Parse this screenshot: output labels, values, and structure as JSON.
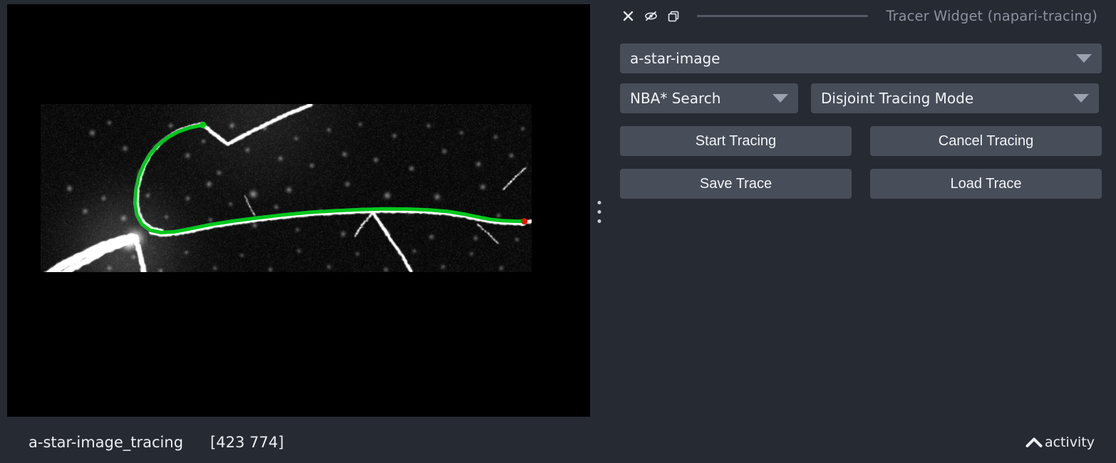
{
  "window": {
    "background_color": "#262a33",
    "panel_color": "#262a33",
    "control_color": "#474d59"
  },
  "dock": {
    "title": "Tracer Widget (napari-tracing)",
    "header_icons": [
      {
        "name": "close-icon",
        "glyph": "x"
      },
      {
        "name": "hide-icon",
        "glyph": "eye-slash"
      },
      {
        "name": "float-icon",
        "glyph": "duplicate-windows"
      }
    ],
    "layer_select": {
      "value": "a-star-image",
      "arrow": "chevron-down-icon"
    },
    "search_select": {
      "value": "NBA* Search",
      "arrow": "chevron-down-icon"
    },
    "mode_select": {
      "value": "Disjoint Tracing Mode",
      "arrow": "chevron-down-icon"
    },
    "buttons": {
      "start_tracing": "Start Tracing",
      "cancel_tracing": "Cancel Tracing",
      "save_trace": "Save Trace",
      "load_trace": "Load Trace"
    }
  },
  "viewer": {
    "image_name": "a-star-image",
    "overlay": {
      "trace_color": "#00c81e",
      "endpoint_color": "#e01b00",
      "start_point_color": "#00c81e"
    }
  },
  "statusbar": {
    "layer_label": "a-star-image_tracing",
    "coordinates": "[423 774]",
    "activity_label": "activity",
    "activity_icon": "chevron-up-icon"
  },
  "chart_data": {
    "type": "scatter",
    "title": "traced neurite path overlay",
    "trace_points_normalized": [
      [
        0.33,
        0.125
      ],
      [
        0.305,
        0.14
      ],
      [
        0.28,
        0.165
      ],
      [
        0.258,
        0.2
      ],
      [
        0.238,
        0.245
      ],
      [
        0.222,
        0.3
      ],
      [
        0.21,
        0.36
      ],
      [
        0.2,
        0.43
      ],
      [
        0.194,
        0.51
      ],
      [
        0.192,
        0.59
      ],
      [
        0.196,
        0.66
      ],
      [
        0.206,
        0.715
      ],
      [
        0.222,
        0.75
      ],
      [
        0.245,
        0.765
      ],
      [
        0.272,
        0.76
      ],
      [
        0.305,
        0.742
      ],
      [
        0.345,
        0.718
      ],
      [
        0.39,
        0.697
      ],
      [
        0.44,
        0.678
      ],
      [
        0.492,
        0.66
      ],
      [
        0.545,
        0.645
      ],
      [
        0.6,
        0.635
      ],
      [
        0.65,
        0.628
      ],
      [
        0.7,
        0.624
      ],
      [
        0.748,
        0.625
      ],
      [
        0.792,
        0.63
      ],
      [
        0.83,
        0.64
      ],
      [
        0.862,
        0.655
      ],
      [
        0.89,
        0.672
      ],
      [
        0.915,
        0.686
      ],
      [
        0.94,
        0.694
      ],
      [
        0.965,
        0.697
      ],
      [
        0.985,
        0.698
      ]
    ],
    "endpoints": {
      "start_normalized": [
        0.33,
        0.125
      ],
      "end_normalized": [
        0.985,
        0.698
      ]
    }
  }
}
